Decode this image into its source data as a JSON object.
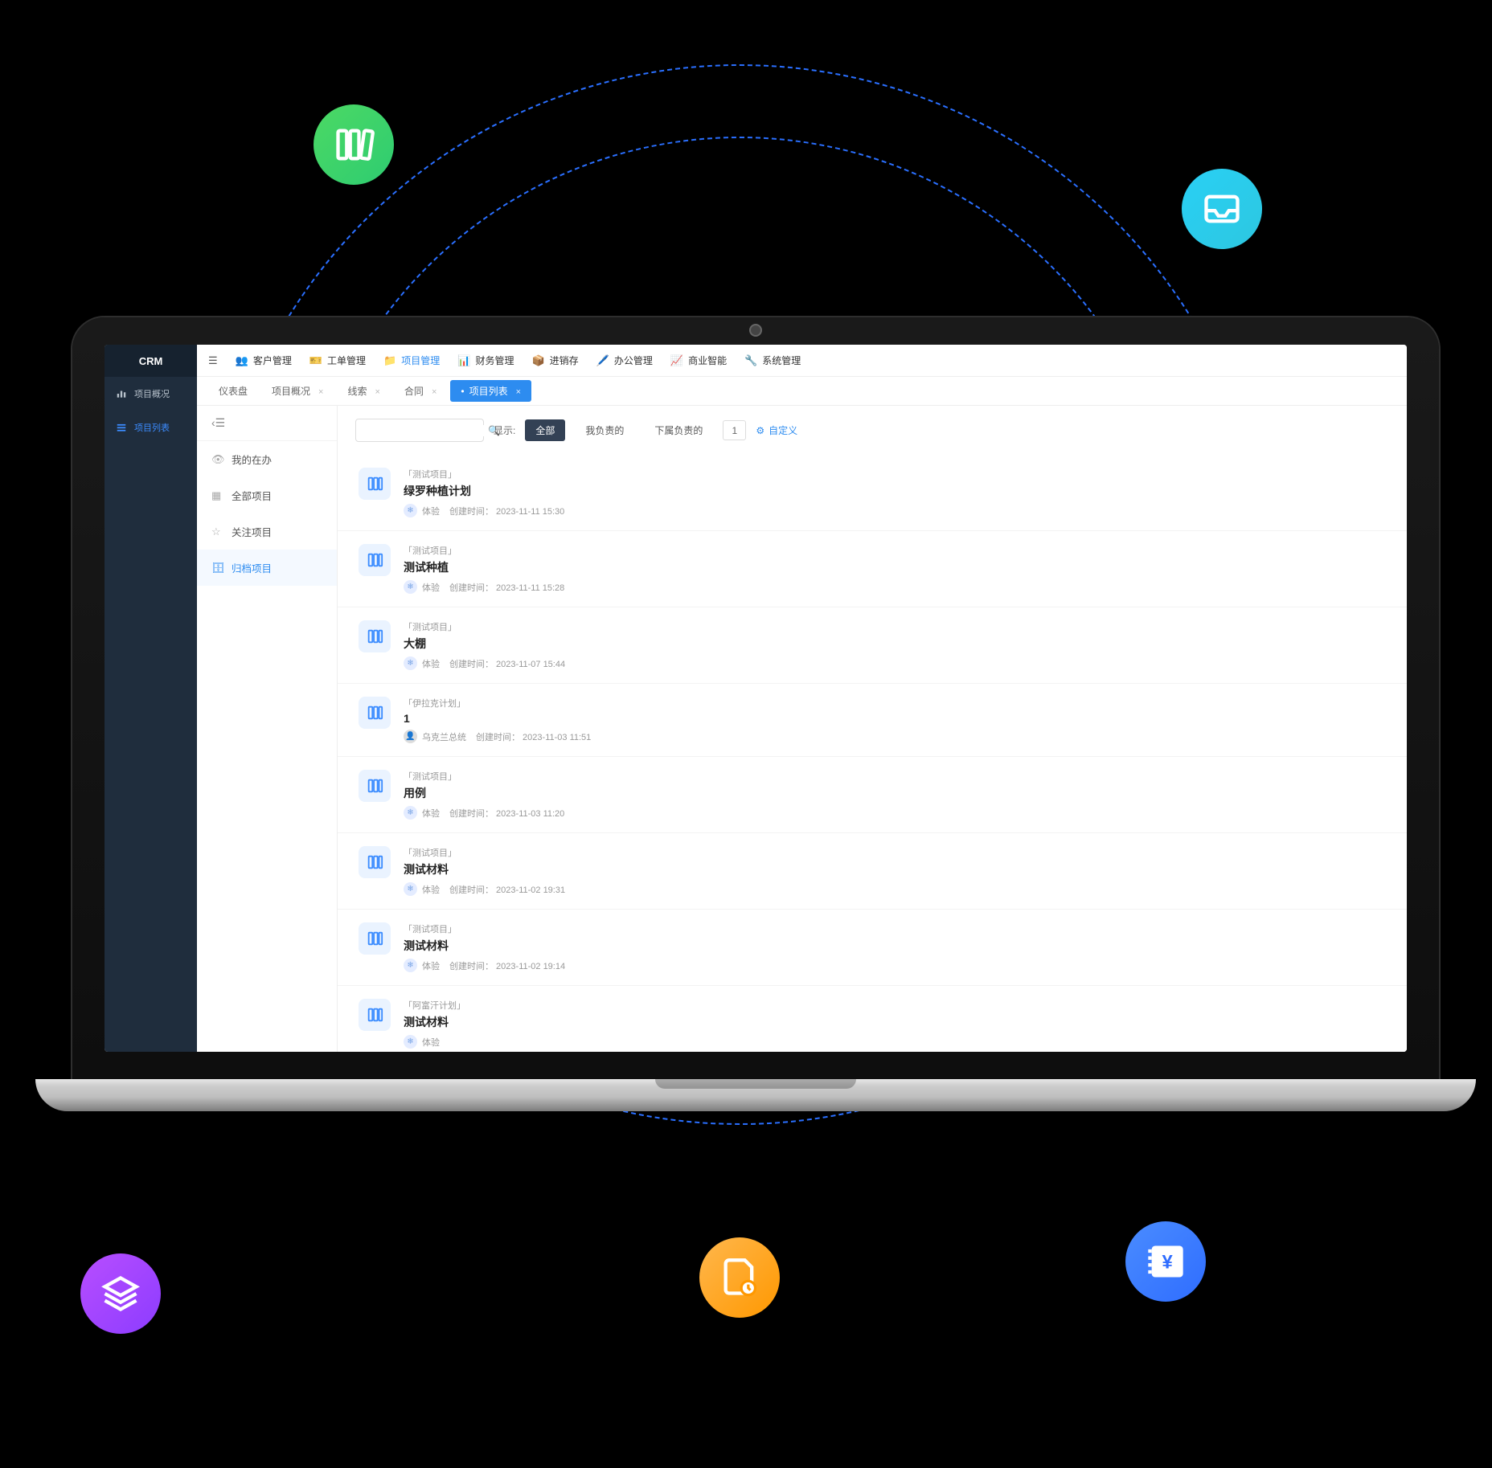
{
  "sidebar": {
    "logo": "CRM",
    "items": [
      {
        "icon": "bars",
        "label": "项目概况"
      },
      {
        "icon": "list",
        "label": "项目列表"
      }
    ]
  },
  "topNav": [
    {
      "icon": "menu",
      "label": ""
    },
    {
      "icon": "people",
      "label": "客户管理"
    },
    {
      "icon": "ticket",
      "label": "工单管理"
    },
    {
      "icon": "project",
      "label": "项目管理",
      "active": true
    },
    {
      "icon": "finance",
      "label": "财务管理"
    },
    {
      "icon": "box",
      "label": "进销存"
    },
    {
      "icon": "office",
      "label": "办公管理"
    },
    {
      "icon": "bi",
      "label": "商业智能"
    },
    {
      "icon": "gear",
      "label": "系统管理"
    }
  ],
  "tabs": [
    {
      "label": "仪表盘"
    },
    {
      "label": "项目概况",
      "close": true
    },
    {
      "label": "线索",
      "close": true
    },
    {
      "label": "合同",
      "close": true
    },
    {
      "label": "项目列表",
      "close": true,
      "active": true
    }
  ],
  "subnav": [
    {
      "icon": "eye",
      "label": "我的在办"
    },
    {
      "icon": "grid",
      "label": "全部项目"
    },
    {
      "icon": "star",
      "label": "关注项目"
    },
    {
      "icon": "archive",
      "label": "归档项目",
      "active": true
    }
  ],
  "search": {
    "placeholder": ""
  },
  "filters": {
    "showLabel": "显示:",
    "chips": [
      {
        "label": "全部",
        "active": true
      },
      {
        "label": "我负责的"
      },
      {
        "label": "下属负责的"
      }
    ],
    "count": "1",
    "customLabel": "自定义"
  },
  "timeLabel": "创建时间：",
  "projects": [
    {
      "cat": "「测试项目」",
      "title": "绿罗种植计划",
      "user": "体验",
      "uava": "blue",
      "time": "2023-11-11 15:30"
    },
    {
      "cat": "「测试项目」",
      "title": "测试种植",
      "user": "体验",
      "uava": "blue",
      "time": "2023-11-11 15:28"
    },
    {
      "cat": "「测试项目」",
      "title": "大棚",
      "user": "体验",
      "uava": "blue",
      "time": "2023-11-07 15:44"
    },
    {
      "cat": "「伊拉克计划」",
      "title": "1",
      "user": "乌克兰总统",
      "uava": "gray",
      "time": "2023-11-03 11:51"
    },
    {
      "cat": "「测试项目」",
      "title": "用例",
      "user": "体验",
      "uava": "blue",
      "time": "2023-11-03 11:20"
    },
    {
      "cat": "「测试项目」",
      "title": "测试材料",
      "user": "体验",
      "uava": "blue",
      "time": "2023-11-02 19:31"
    },
    {
      "cat": "「测试项目」",
      "title": "测试材料",
      "user": "体验",
      "uava": "blue",
      "time": "2023-11-02 19:14"
    },
    {
      "cat": "「阿富汗计划」",
      "title": "测试材料",
      "user": "体验",
      "uava": "blue",
      "time": ""
    }
  ]
}
